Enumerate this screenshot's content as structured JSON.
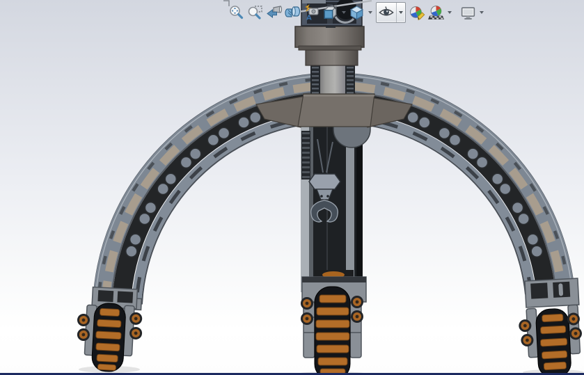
{
  "app": {
    "name": "SOLIDWORKS 3D assembly viewport"
  },
  "heads_up_toolbar": {
    "buttons": [
      {
        "name": "Zoom to Fit",
        "icon": "zoom-to-fit-icon",
        "dropdown": false
      },
      {
        "name": "Zoom to Area",
        "icon": "zoom-to-area-icon",
        "dropdown": false
      },
      {
        "name": "Previous View",
        "icon": "previous-view-icon",
        "dropdown": false
      },
      {
        "name": "Section View",
        "icon": "section-view-icon",
        "dropdown": false
      },
      {
        "name": "Dynamic Annotation Views",
        "icon": "annotation-views-icon",
        "dropdown": false
      },
      {
        "name": "View Orientation",
        "icon": "view-orientation-icon",
        "dropdown": true
      },
      {
        "name": "Display Style",
        "icon": "display-style-icon",
        "dropdown": true
      },
      {
        "name": "Hide/Show Items",
        "icon": "hide-show-items-eye-icon",
        "dropdown": true
      },
      {
        "name": "Edit Appearance",
        "icon": "edit-appearance-icon",
        "dropdown": false
      },
      {
        "name": "Apply Scene",
        "icon": "apply-scene-icon",
        "dropdown": true
      },
      {
        "name": "View Settings",
        "icon": "view-settings-icon",
        "dropdown": true
      }
    ]
  },
  "viewport": {
    "background_top": "#d3d7e0",
    "background_bottom": "#ffffff",
    "status_strip_color": "#1c2a60",
    "model": {
      "name": "three-legged arched wheel robot with crane hook",
      "colors": {
        "archGray": "#7d8793",
        "archEdge": "#4a5058",
        "archLight": "#a8b0b9",
        "archSlotTan": "#a89d8e",
        "archSlit": "#4b5158",
        "archChannel": "#232527",
        "archRim": "#828c98",
        "roller": "#7f8894",
        "mastLight": "#aab0b6",
        "mastDark": "#1e2124",
        "mastHighlight": "#8d949b",
        "hookGray": "#99a1ac",
        "hookDark": "#454e58",
        "housing": "#6d747c",
        "bracketWarm": "#76706a",
        "turret": "#4e5765",
        "turretDark": "#262a31",
        "tire": "#131519",
        "wheelOrange": "#b36d28",
        "fork": "#8a9097",
        "sideRollerOrange": "#a86524",
        "rodDark": "#24282d"
      }
    }
  }
}
